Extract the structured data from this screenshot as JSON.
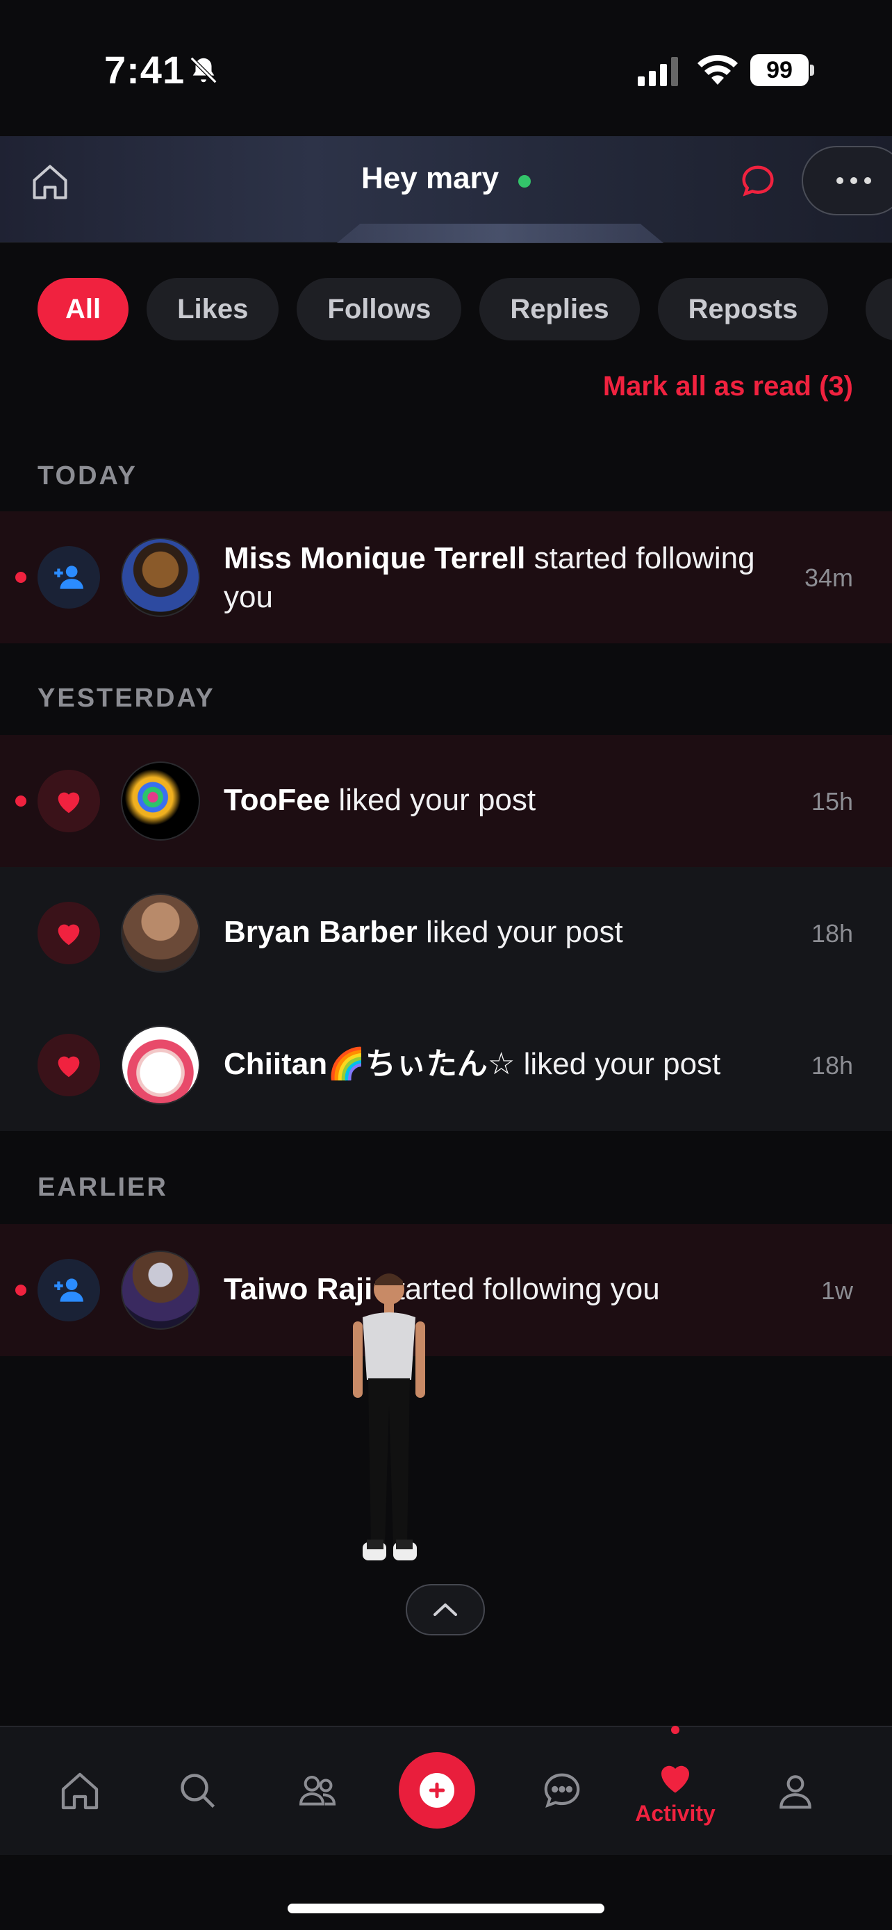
{
  "status_bar": {
    "time": "7:41",
    "battery": "99"
  },
  "header": {
    "title": "Hey mary"
  },
  "tabs": [
    {
      "label": "All",
      "active": true
    },
    {
      "label": "Likes",
      "active": false
    },
    {
      "label": "Follows",
      "active": false
    },
    {
      "label": "Replies",
      "active": false
    },
    {
      "label": "Reposts",
      "active": false
    }
  ],
  "mark_all_read": "Mark all as read (3)",
  "sections": {
    "today": "TODAY",
    "yesterday": "YESTERDAY",
    "earlier": "EARLIER"
  },
  "notifications": [
    {
      "name": "Miss Monique Terrell",
      "action": "started following you",
      "time": "34m",
      "type": "follow",
      "unread": true
    },
    {
      "name": "TooFee",
      "action": "liked your post",
      "time": "15h",
      "type": "like",
      "unread": true
    },
    {
      "name": "Bryan Barber",
      "action": "liked your post",
      "time": "18h",
      "type": "like",
      "unread": false
    },
    {
      "name": "Chiitan🌈ちぃたん☆",
      "action": "liked your post",
      "time": "18h",
      "type": "like",
      "unread": false
    },
    {
      "name": "Taiwo Raji",
      "action": "started following you",
      "time": "1w",
      "type": "follow",
      "unread": true
    }
  ],
  "nav": {
    "items": [
      "home-icon",
      "search-icon",
      "people-icon",
      "plus-icon",
      "chat-bubble-icon",
      "heart-icon",
      "profile-icon"
    ],
    "activity_label": "Activity"
  },
  "colors": {
    "accent": "#f0223f",
    "online": "#33c46a",
    "follow": "#2b8cff"
  }
}
